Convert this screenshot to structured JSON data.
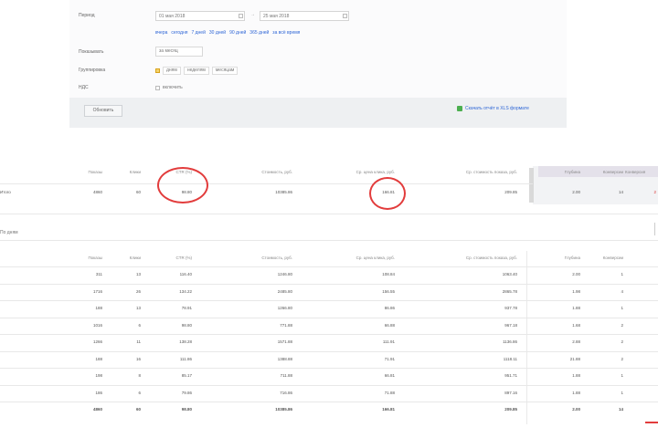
{
  "filters": {
    "period_label": "Период",
    "date_from": "01 мая 2018",
    "date_to": "25 мая 2018",
    "quick_periods": [
      "вчера",
      "сегодня",
      "7 дней",
      "30 дней",
      "90 дней",
      "365 дней",
      "за всё время"
    ],
    "campaign_label": "Показывать",
    "campaign_value": "за месяц",
    "group_label": "Группировка",
    "group_options": [
      "дням",
      "неделям",
      "месяцам"
    ],
    "nds_label": "НДС",
    "nds_option": "включить",
    "refresh_label": "Обновить",
    "export_label": "Скачать отчёт в XLS формате"
  },
  "summary": {
    "headers": [
      "Показы",
      "Клики",
      "CTR (%)",
      "Стоимость, руб.",
      "Ср. цена клика, руб.",
      "Ср. стоимость показа, руб."
    ],
    "row_label": "Итого",
    "row": [
      "4860",
      "60",
      "98.80",
      "10385.86",
      "166.81",
      "209.85"
    ],
    "side_headers": [
      "Глубина",
      "Конверсии",
      "Конверсия"
    ],
    "side_row": [
      "2.00",
      "14",
      "2"
    ]
  },
  "detail": {
    "section_label": "По дням",
    "headers": [
      "Показы",
      "Клики",
      "CTR (%)",
      "Стоимость, руб.",
      "Ср. цена клика, руб.",
      "Ср. стоимость показа, руб.",
      "Глубина",
      "Конверсии"
    ],
    "rows": [
      [
        "311",
        "13",
        "116.40",
        "1246.80",
        "108.84",
        "1063.40",
        "2.00",
        "1"
      ],
      [
        "1716",
        "26",
        "134.22",
        "2485.80",
        "156.55",
        "2865.78",
        "1.98",
        "4"
      ],
      [
        "188",
        "13",
        "78.91",
        "1266.80",
        "86.86",
        "937.78",
        "1.88",
        "1"
      ],
      [
        "1016",
        "6",
        "98.80",
        "771.88",
        "66.88",
        "967.18",
        "1.68",
        "2"
      ],
      [
        "1266",
        "11",
        "138.28",
        "1571.88",
        "111.91",
        "1136.86",
        "2.88",
        "2"
      ],
      [
        "188",
        "16",
        "111.86",
        "1388.88",
        "71.91",
        "1118.11",
        "21.88",
        "2"
      ],
      [
        "198",
        "8",
        "85.17",
        "711.88",
        "66.81",
        "951.71",
        "1.88",
        "1"
      ],
      [
        "186",
        "6",
        "79.86",
        "716.86",
        "71.88",
        "897.16",
        "1.88",
        "1"
      ]
    ],
    "total": [
      "4860",
      "60",
      "98.80",
      "10385.86",
      "166.81",
      "209.85",
      "2.00",
      "14"
    ]
  },
  "colors": {
    "accent_link": "#2e66d6",
    "annotation_red": "#e23c3c",
    "export_icon": "#4caf50"
  }
}
